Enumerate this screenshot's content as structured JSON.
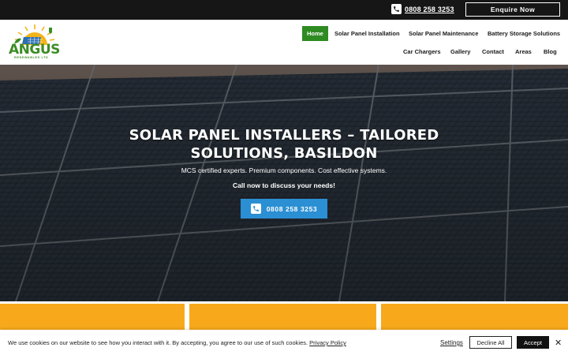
{
  "topbar": {
    "phone": "0808 258 3253",
    "enquire_label": "Enquire Now"
  },
  "logo": {
    "name": "ANGUS",
    "subtitle": "RENEWABLES LTD"
  },
  "nav": {
    "items": [
      {
        "label": "Home",
        "active": true
      },
      {
        "label": "Solar Panel Installation"
      },
      {
        "label": "Solar Panel Maintenance"
      },
      {
        "label": "Battery Storage Solutions"
      },
      {
        "label": "Car Chargers"
      },
      {
        "label": "Gallery"
      },
      {
        "label": "Contact"
      },
      {
        "label": "Areas"
      },
      {
        "label": "Blog"
      }
    ]
  },
  "hero": {
    "title": "SOLAR PANEL INSTALLERS – TAILORED SOLUTIONS, BASILDON",
    "subtitle": "MCS certified experts. Premium components. Cost effective systems.",
    "cta_text": "Call now to discuss your needs!",
    "phone_button": "0808 258 3253"
  },
  "cookie": {
    "text": "We use cookies on our website to see how you interact with it. By accepting, you agree to our use of such cookies.",
    "policy_link": "Privacy Policy",
    "settings_label": "Settings",
    "decline_label": "Decline All",
    "accept_label": "Accept",
    "close_symbol": "✕"
  },
  "colors": {
    "brand_green": "#2e8b22",
    "cta_blue": "#2b8fd3",
    "card_yellow": "#f7a91b",
    "topbar_dark": "#161616"
  }
}
